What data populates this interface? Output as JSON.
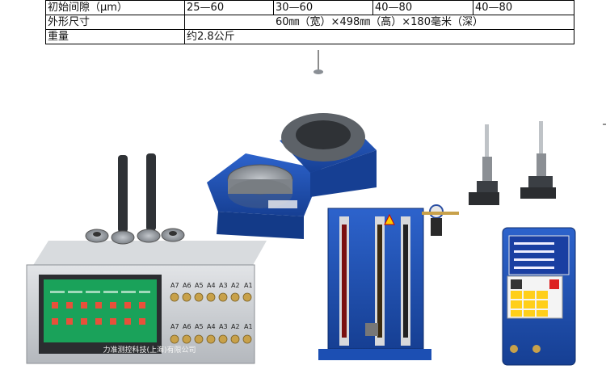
{
  "spec_table": {
    "rows": [
      {
        "label": "初始间隙（μm）",
        "values": [
          "25—60",
          "30—60",
          "40—80",
          "40—80"
        ]
      },
      {
        "label": "外形尺寸",
        "merged": "60㎜（宽）×498㎜（高）×180毫米（深）"
      },
      {
        "label": "重量",
        "merged": "约2.8公斤"
      }
    ]
  },
  "controller": {
    "caption": "力准测控科技(上海)有限公司",
    "port_labels_top": [
      "A7",
      "A6",
      "A5",
      "A4",
      "A3",
      "A2",
      "A1"
    ],
    "port_labels_bottom": [
      "A7",
      "A6",
      "A5",
      "A4",
      "A3",
      "A2",
      "A1"
    ]
  },
  "colors": {
    "table_border": "#000000",
    "panel_silver": "#c9ccd0",
    "screen_green": "#1fa35a",
    "device_blue": "#1c4fb3",
    "gauge_steel": "#6d7278"
  }
}
